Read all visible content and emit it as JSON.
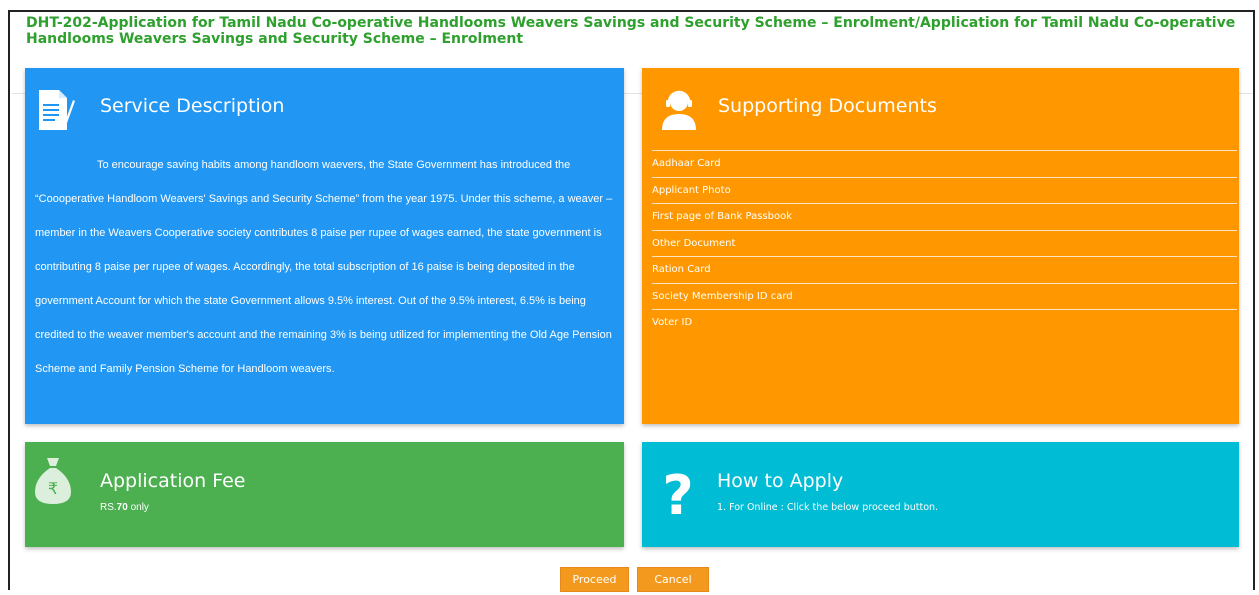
{
  "page": {
    "title": "DHT-202-Application for Tamil Nadu Co-operative Handlooms Weavers Savings and Security Scheme – Enrolment/Application for Tamil Nadu Co-operative Handlooms Weavers Savings and Security Scheme – Enrolment"
  },
  "service": {
    "heading": "Service Description",
    "icon": "document-pen-icon",
    "text": "To encourage saving habits among handloom waevers, the State Government has introduced the “Coooperative Handloom Weavers' Savings and Security Scheme” from the year 1975. Under this scheme, a weaver – member in the Weavers Cooperative society contributes 8 paise per rupee of wages earned, the state government is contributing 8 paise per rupee of wages. Accordingly, the total subscription of 16 paise is being deposited in the government Account for which the state Government allows 9.5% interest. Out of the 9.5% interest, 6.5% is being credited to the weaver member's account and the remaining 3% is being utilized for implementing the Old Age Pension Scheme and Family Pension Scheme for Handloom weavers.",
    "color": "#2196f3"
  },
  "documents": {
    "heading": "Supporting Documents",
    "icon": "headset-user-icon",
    "items": [
      "Aadhaar Card",
      "Applicant Photo",
      "First page of Bank Passbook",
      "Other Document",
      "Ration Card",
      "Society Membership ID card",
      "Voter ID"
    ],
    "color": "#ff9800"
  },
  "fee": {
    "heading": "Application Fee",
    "icon": "money-bag-rupee-icon",
    "prefix": "RS.",
    "amount": "70",
    "suffix": " only",
    "color": "#4caf50"
  },
  "howto": {
    "heading": "How to Apply",
    "icon": "question-mark-icon",
    "step": "1. For Online : Click the below proceed button.",
    "color": "#00bcd4"
  },
  "buttons": {
    "proceed": "Proceed",
    "cancel": "Cancel",
    "color": "#f39a1e"
  }
}
